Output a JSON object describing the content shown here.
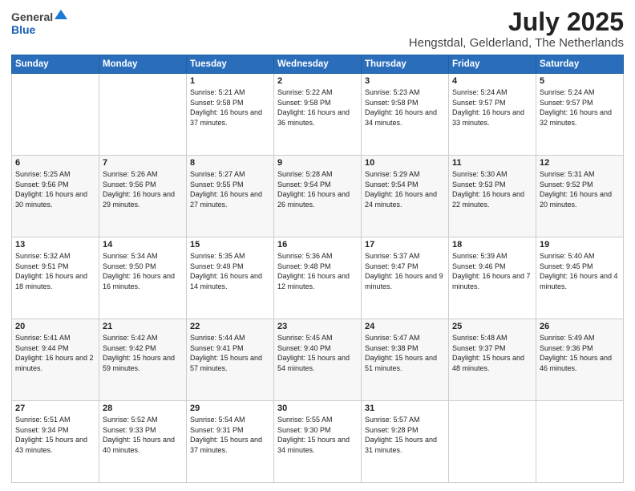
{
  "header": {
    "logo": {
      "line1": "General",
      "line2": "Blue"
    },
    "title": "July 2025",
    "subtitle": "Hengstdal, Gelderland, The Netherlands"
  },
  "weekdays": [
    "Sunday",
    "Monday",
    "Tuesday",
    "Wednesday",
    "Thursday",
    "Friday",
    "Saturday"
  ],
  "weeks": [
    [
      {
        "day": "",
        "text": ""
      },
      {
        "day": "",
        "text": ""
      },
      {
        "day": "1",
        "text": "Sunrise: 5:21 AM\nSunset: 9:58 PM\nDaylight: 16 hours\nand 37 minutes."
      },
      {
        "day": "2",
        "text": "Sunrise: 5:22 AM\nSunset: 9:58 PM\nDaylight: 16 hours\nand 36 minutes."
      },
      {
        "day": "3",
        "text": "Sunrise: 5:23 AM\nSunset: 9:58 PM\nDaylight: 16 hours\nand 34 minutes."
      },
      {
        "day": "4",
        "text": "Sunrise: 5:24 AM\nSunset: 9:57 PM\nDaylight: 16 hours\nand 33 minutes."
      },
      {
        "day": "5",
        "text": "Sunrise: 5:24 AM\nSunset: 9:57 PM\nDaylight: 16 hours\nand 32 minutes."
      }
    ],
    [
      {
        "day": "6",
        "text": "Sunrise: 5:25 AM\nSunset: 9:56 PM\nDaylight: 16 hours\nand 30 minutes."
      },
      {
        "day": "7",
        "text": "Sunrise: 5:26 AM\nSunset: 9:56 PM\nDaylight: 16 hours\nand 29 minutes."
      },
      {
        "day": "8",
        "text": "Sunrise: 5:27 AM\nSunset: 9:55 PM\nDaylight: 16 hours\nand 27 minutes."
      },
      {
        "day": "9",
        "text": "Sunrise: 5:28 AM\nSunset: 9:54 PM\nDaylight: 16 hours\nand 26 minutes."
      },
      {
        "day": "10",
        "text": "Sunrise: 5:29 AM\nSunset: 9:54 PM\nDaylight: 16 hours\nand 24 minutes."
      },
      {
        "day": "11",
        "text": "Sunrise: 5:30 AM\nSunset: 9:53 PM\nDaylight: 16 hours\nand 22 minutes."
      },
      {
        "day": "12",
        "text": "Sunrise: 5:31 AM\nSunset: 9:52 PM\nDaylight: 16 hours\nand 20 minutes."
      }
    ],
    [
      {
        "day": "13",
        "text": "Sunrise: 5:32 AM\nSunset: 9:51 PM\nDaylight: 16 hours\nand 18 minutes."
      },
      {
        "day": "14",
        "text": "Sunrise: 5:34 AM\nSunset: 9:50 PM\nDaylight: 16 hours\nand 16 minutes."
      },
      {
        "day": "15",
        "text": "Sunrise: 5:35 AM\nSunset: 9:49 PM\nDaylight: 16 hours\nand 14 minutes."
      },
      {
        "day": "16",
        "text": "Sunrise: 5:36 AM\nSunset: 9:48 PM\nDaylight: 16 hours\nand 12 minutes."
      },
      {
        "day": "17",
        "text": "Sunrise: 5:37 AM\nSunset: 9:47 PM\nDaylight: 16 hours\nand 9 minutes."
      },
      {
        "day": "18",
        "text": "Sunrise: 5:39 AM\nSunset: 9:46 PM\nDaylight: 16 hours\nand 7 minutes."
      },
      {
        "day": "19",
        "text": "Sunrise: 5:40 AM\nSunset: 9:45 PM\nDaylight: 16 hours\nand 4 minutes."
      }
    ],
    [
      {
        "day": "20",
        "text": "Sunrise: 5:41 AM\nSunset: 9:44 PM\nDaylight: 16 hours\nand 2 minutes."
      },
      {
        "day": "21",
        "text": "Sunrise: 5:42 AM\nSunset: 9:42 PM\nDaylight: 15 hours\nand 59 minutes."
      },
      {
        "day": "22",
        "text": "Sunrise: 5:44 AM\nSunset: 9:41 PM\nDaylight: 15 hours\nand 57 minutes."
      },
      {
        "day": "23",
        "text": "Sunrise: 5:45 AM\nSunset: 9:40 PM\nDaylight: 15 hours\nand 54 minutes."
      },
      {
        "day": "24",
        "text": "Sunrise: 5:47 AM\nSunset: 9:38 PM\nDaylight: 15 hours\nand 51 minutes."
      },
      {
        "day": "25",
        "text": "Sunrise: 5:48 AM\nSunset: 9:37 PM\nDaylight: 15 hours\nand 48 minutes."
      },
      {
        "day": "26",
        "text": "Sunrise: 5:49 AM\nSunset: 9:36 PM\nDaylight: 15 hours\nand 46 minutes."
      }
    ],
    [
      {
        "day": "27",
        "text": "Sunrise: 5:51 AM\nSunset: 9:34 PM\nDaylight: 15 hours\nand 43 minutes."
      },
      {
        "day": "28",
        "text": "Sunrise: 5:52 AM\nSunset: 9:33 PM\nDaylight: 15 hours\nand 40 minutes."
      },
      {
        "day": "29",
        "text": "Sunrise: 5:54 AM\nSunset: 9:31 PM\nDaylight: 15 hours\nand 37 minutes."
      },
      {
        "day": "30",
        "text": "Sunrise: 5:55 AM\nSunset: 9:30 PM\nDaylight: 15 hours\nand 34 minutes."
      },
      {
        "day": "31",
        "text": "Sunrise: 5:57 AM\nSunset: 9:28 PM\nDaylight: 15 hours\nand 31 minutes."
      },
      {
        "day": "",
        "text": ""
      },
      {
        "day": "",
        "text": ""
      }
    ]
  ]
}
